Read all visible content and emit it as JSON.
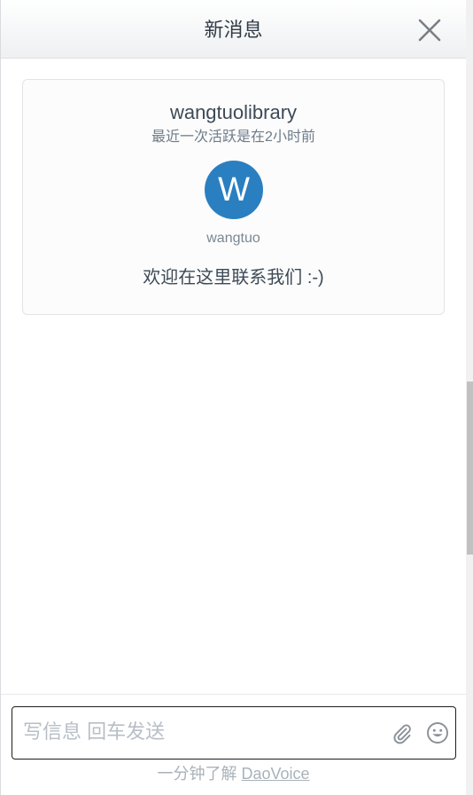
{
  "header": {
    "title": "新消息",
    "close_icon": "close-icon"
  },
  "card": {
    "team_name": "wangtuolibrary",
    "last_active": "最近一次活跃是在2小时前",
    "avatar_letter": "W",
    "avatar_color": "#2a7fc0",
    "agent_name": "wangtuo",
    "welcome_message": "欢迎在这里联系我们 :-)"
  },
  "composer": {
    "placeholder": "写信息 回车发送",
    "attach_icon": "paperclip-icon",
    "emoji_icon": "smiley-icon"
  },
  "footer": {
    "prefix": "一分钟了解 ",
    "link_text": "DaoVoice"
  }
}
